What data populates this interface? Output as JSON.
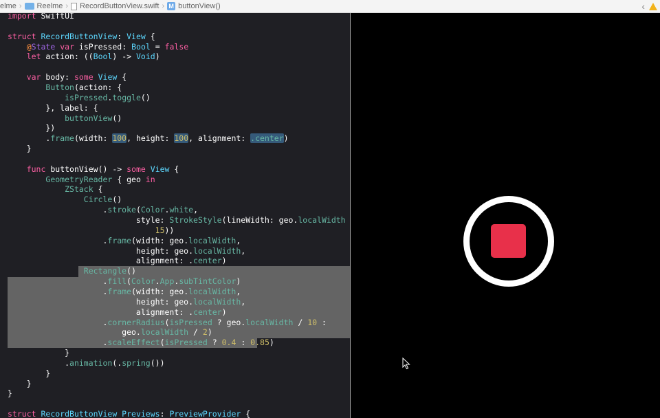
{
  "breadcrumb": {
    "items": [
      "elme",
      "Reelme",
      "RecordButtonView.swift",
      "buttonView()"
    ]
  },
  "colors": {
    "record_fill": "#e8304a",
    "ring": "#ffffff",
    "editor_bg": "#1f1f24",
    "selection": "#646464"
  },
  "editor": {
    "lines": [
      [
        [
          "kw",
          "import"
        ],
        [
          "pl",
          " SwiftUI"
        ]
      ],
      [],
      [
        [
          "kw",
          "struct"
        ],
        [
          "pl",
          " "
        ],
        [
          "decl",
          "RecordButtonView"
        ],
        [
          "pl",
          ": "
        ],
        [
          "tyd",
          "View"
        ],
        [
          "pl",
          " {"
        ]
      ],
      [
        [
          "pl",
          "    "
        ],
        [
          "at",
          "@"
        ],
        [
          "fnc",
          "State"
        ],
        [
          "pl",
          " "
        ],
        [
          "kw",
          "var"
        ],
        [
          "pl",
          " "
        ],
        [
          "pl",
          "isPressed"
        ],
        [
          "pl",
          ": "
        ],
        [
          "tyd",
          "Bool"
        ],
        [
          "pl",
          " = "
        ],
        [
          "kw",
          "false"
        ]
      ],
      [
        [
          "pl",
          "    "
        ],
        [
          "kw",
          "let"
        ],
        [
          "pl",
          " action: (("
        ],
        [
          "tyd",
          "Bool"
        ],
        [
          "pl",
          ") -> "
        ],
        [
          "tyd",
          "Void"
        ],
        [
          "pl",
          ")"
        ]
      ],
      [],
      [
        [
          "pl",
          "    "
        ],
        [
          "kw",
          "var"
        ],
        [
          "pl",
          " body: "
        ],
        [
          "kw",
          "some"
        ],
        [
          "pl",
          " "
        ],
        [
          "tyd",
          "View"
        ],
        [
          "pl",
          " {"
        ]
      ],
      [
        [
          "pl",
          "        "
        ],
        [
          "fn",
          "Button"
        ],
        [
          "pl",
          "(action: {"
        ]
      ],
      [
        [
          "pl",
          "            "
        ],
        [
          "fn",
          "isPressed"
        ],
        [
          "pl",
          "."
        ],
        [
          "fn",
          "toggle"
        ],
        [
          "pl",
          "()"
        ]
      ],
      [
        [
          "pl",
          "        }, label: {"
        ]
      ],
      [
        [
          "pl",
          "            "
        ],
        [
          "fn",
          "buttonView"
        ],
        [
          "pl",
          "()"
        ]
      ],
      [
        [
          "pl",
          "        })"
        ]
      ],
      [
        [
          "pl",
          "        ."
        ],
        [
          "fn",
          "frame"
        ],
        [
          "pl",
          "(width: "
        ],
        [
          "num hl",
          "100"
        ],
        [
          "pl",
          ", height: "
        ],
        [
          "num hl",
          "100"
        ],
        [
          "pl",
          ", alignment: "
        ],
        [
          "fn hl",
          ".center"
        ],
        [
          "pl",
          ")"
        ]
      ],
      [
        [
          "pl",
          "    }"
        ]
      ],
      [],
      [
        [
          "pl",
          "    "
        ],
        [
          "kw",
          "func"
        ],
        [
          "pl",
          " "
        ],
        [
          "pl",
          "buttonView"
        ],
        [
          "pl",
          "() -> "
        ],
        [
          "kw",
          "some"
        ],
        [
          "pl",
          " "
        ],
        [
          "tyd",
          "View"
        ],
        [
          "pl",
          " {"
        ]
      ],
      [
        [
          "pl",
          "        "
        ],
        [
          "fn",
          "GeometryReader"
        ],
        [
          "pl",
          " { geo "
        ],
        [
          "kw",
          "in"
        ]
      ],
      [
        [
          "pl",
          "            "
        ],
        [
          "fn",
          "ZStack"
        ],
        [
          "pl",
          " {"
        ]
      ],
      [
        [
          "pl",
          "                "
        ],
        [
          "fn",
          "Circle"
        ],
        [
          "pl",
          "()"
        ]
      ],
      [
        [
          "pl",
          "                    ."
        ],
        [
          "fn",
          "stroke"
        ],
        [
          "pl",
          "("
        ],
        [
          "fn",
          "Color"
        ],
        [
          "pl",
          "."
        ],
        [
          "fn",
          "white"
        ],
        [
          "pl",
          ","
        ]
      ],
      [
        [
          "pl",
          "                           style: "
        ],
        [
          "fn",
          "StrokeStyle"
        ],
        [
          "pl",
          "(lineWidth: geo."
        ],
        [
          "fn",
          "localWidth"
        ],
        [
          "pl",
          " /"
        ]
      ],
      [
        [
          "pl",
          "                               "
        ],
        [
          "num",
          "15"
        ],
        [
          "pl",
          "))"
        ]
      ],
      [
        [
          "pl",
          "                    ."
        ],
        [
          "fn",
          "frame"
        ],
        [
          "pl",
          "(width: geo."
        ],
        [
          "fn",
          "localWidth"
        ],
        [
          "pl",
          ","
        ]
      ],
      [
        [
          "pl",
          "                           height: geo."
        ],
        [
          "fn",
          "localWidth"
        ],
        [
          "pl",
          ","
        ]
      ],
      [
        [
          "pl",
          "                           alignment: ."
        ],
        [
          "fn",
          "center"
        ],
        [
          "pl",
          ")"
        ]
      ],
      [
        [
          "pl",
          "                "
        ],
        [
          "fn",
          "Rectangle"
        ],
        [
          "pl",
          "()"
        ]
      ],
      [
        [
          "pl",
          "                    ."
        ],
        [
          "fn",
          "fill"
        ],
        [
          "pl",
          "("
        ],
        [
          "fn",
          "Color"
        ],
        [
          "pl",
          "."
        ],
        [
          "fn",
          "App"
        ],
        [
          "pl",
          "."
        ],
        [
          "fn",
          "subTintColor"
        ],
        [
          "pl",
          ")"
        ]
      ],
      [
        [
          "pl",
          "                    ."
        ],
        [
          "fn",
          "frame"
        ],
        [
          "pl",
          "(width: geo."
        ],
        [
          "fn",
          "localWidth"
        ],
        [
          "pl",
          ","
        ]
      ],
      [
        [
          "pl",
          "                           height: geo."
        ],
        [
          "fn",
          "localWidth"
        ],
        [
          "pl",
          ","
        ]
      ],
      [
        [
          "pl",
          "                           alignment: ."
        ],
        [
          "fn",
          "center"
        ],
        [
          "pl",
          ")"
        ]
      ],
      [
        [
          "pl",
          "                    ."
        ],
        [
          "fn",
          "cornerRadius"
        ],
        [
          "pl",
          "("
        ],
        [
          "fn",
          "isPressed"
        ],
        [
          "pl",
          " ? geo."
        ],
        [
          "fn",
          "localWidth"
        ],
        [
          "pl",
          " / "
        ],
        [
          "num",
          "10"
        ],
        [
          "pl",
          " :"
        ]
      ],
      [
        [
          "pl",
          "                        geo."
        ],
        [
          "fn",
          "localWidth"
        ],
        [
          "pl",
          " / "
        ],
        [
          "num",
          "2"
        ],
        [
          "pl",
          ")"
        ]
      ],
      [
        [
          "pl",
          "                    ."
        ],
        [
          "fn",
          "scaleEffect"
        ],
        [
          "pl",
          "("
        ],
        [
          "fn",
          "isPressed"
        ],
        [
          "pl",
          " ? "
        ],
        [
          "num",
          "0.4"
        ],
        [
          "pl",
          " : "
        ],
        [
          "num",
          "0.85"
        ],
        [
          "pl",
          ")"
        ]
      ],
      [
        [
          "pl",
          "            }"
        ]
      ],
      [
        [
          "pl",
          "            ."
        ],
        [
          "fn",
          "animation"
        ],
        [
          "pl",
          "(."
        ],
        [
          "fn",
          "spring"
        ],
        [
          "pl",
          "())"
        ]
      ],
      [
        [
          "pl",
          "        }"
        ]
      ],
      [
        [
          "pl",
          "    }"
        ]
      ],
      [
        [
          "pl",
          "}"
        ]
      ],
      [],
      [
        [
          "kw",
          "struct"
        ],
        [
          "pl",
          " "
        ],
        [
          "decl",
          "RecordButtonView_Previews"
        ],
        [
          "pl",
          ": "
        ],
        [
          "tyd",
          "PreviewProvider"
        ],
        [
          "pl",
          " {"
        ]
      ]
    ]
  }
}
